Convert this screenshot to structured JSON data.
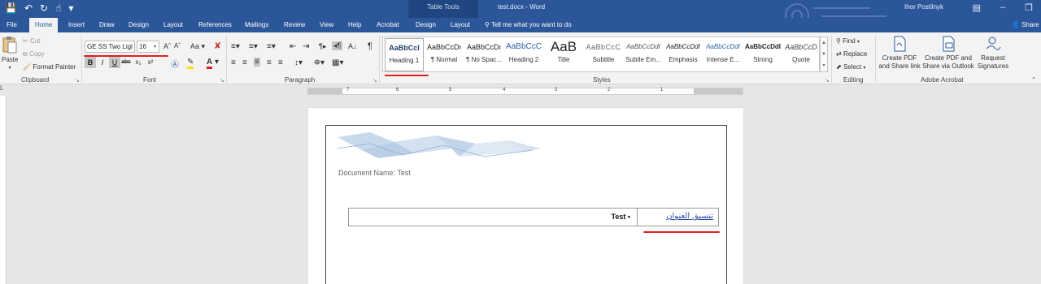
{
  "titlebar": {
    "context_tab_title": "Table Tools",
    "document_title": "test.docx  -  Word",
    "user": "Ihor Postilnyk"
  },
  "tabs": [
    "File",
    "Home",
    "Insert",
    "Draw",
    "Design",
    "Layout",
    "References",
    "Mailings",
    "Review",
    "View",
    "Help",
    "Acrobat",
    "Design",
    "Layout"
  ],
  "active_tab": "Home",
  "tell_me": "Tell me what you want to do",
  "share": "Share",
  "clipboard": {
    "paste": "Paste",
    "cut": "Cut",
    "copy": "Copy",
    "format_painter": "Format Painter",
    "label": "Clipboard"
  },
  "font": {
    "name": "GE SS Two Ligl",
    "size": "16",
    "label": "Font",
    "bold": "B",
    "italic": "I",
    "underline": "U",
    "strike": "abc",
    "sub": "x₂",
    "sup": "x²"
  },
  "paragraph": {
    "label": "Paragraph"
  },
  "styles": {
    "label": "Styles",
    "items": [
      {
        "sample": "AaBbCcI",
        "name": "Heading 1"
      },
      {
        "sample": "AaBbCcDı",
        "name": "¶ Normal"
      },
      {
        "sample": "AaBbCcDı",
        "name": "¶ No Spac..."
      },
      {
        "sample": "AaBbCcC",
        "name": "Heading 2"
      },
      {
        "sample": "AaB",
        "name": "Title"
      },
      {
        "sample": "AaBbCcC",
        "name": "Subtitle"
      },
      {
        "sample": "AaBbCcDdI",
        "name": "Subtle Em..."
      },
      {
        "sample": "AaBbCcDdI",
        "name": "Emphasis"
      },
      {
        "sample": "AaBbCcDdI",
        "name": "Intense E..."
      },
      {
        "sample": "AaBbCcDdI",
        "name": "Strong"
      },
      {
        "sample": "AaBbCcD",
        "name": "Quote"
      }
    ]
  },
  "editing": {
    "find": "Find",
    "replace": "Replace",
    "select": "Select",
    "label": "Editing"
  },
  "acrobat": {
    "create_pdf": "Create PDF and Share link",
    "create_pdf_outlook": "Create PDF and Share via Outlook",
    "request_signatures": "Request Signatures",
    "label": "Adobe Acrobat"
  },
  "ruler": {
    "numbers": [
      "7",
      "6",
      "5",
      "4",
      "3",
      "2",
      "1"
    ]
  },
  "document": {
    "doc_name": "Document Name: Test",
    "cell_left": "Test •",
    "cell_right": "تنسيق العنوان"
  },
  "colors": {
    "accent": "#2b579a",
    "annotation": "#e02020",
    "link": "#2b4fa3"
  }
}
